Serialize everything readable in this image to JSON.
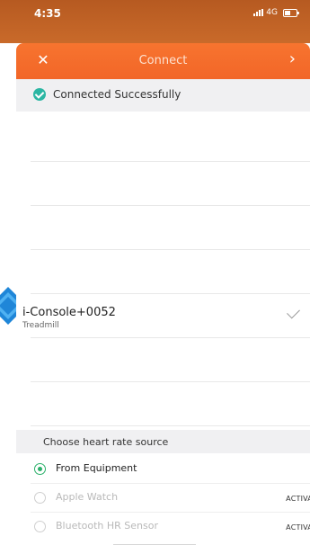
{
  "status_bar": {
    "time": "4:35",
    "network": "4G"
  },
  "header": {
    "title": "Connect",
    "close_icon": "close-icon",
    "next_icon": "chevron-right-icon"
  },
  "success": {
    "text": "Connected Successfully",
    "icon": "check-circle-icon",
    "color": "#2bb6a3"
  },
  "devices": [
    {
      "name": "i-Console+0052",
      "type": "Treadmill",
      "selected": true
    }
  ],
  "heart_rate": {
    "title": "Choose heart rate source",
    "options": [
      {
        "label": "From Equipment",
        "selected": true,
        "action": ""
      },
      {
        "label": "Apple Watch",
        "selected": false,
        "action": "ACTIVATI"
      },
      {
        "label": "Bluetooth HR Sensor",
        "selected": false,
        "action": "ACTIVATI"
      }
    ]
  },
  "colors": {
    "accent": "#f26628",
    "success": "#2bb6a3",
    "radio": "#2bb06a"
  }
}
